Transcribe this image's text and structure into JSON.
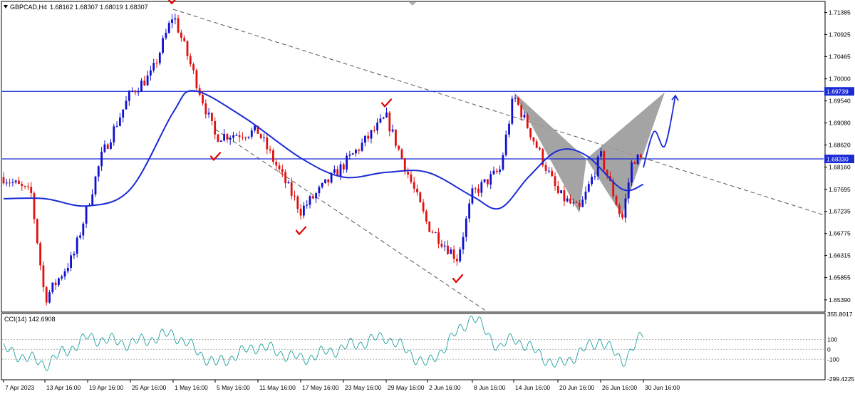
{
  "symbol_header": {
    "symbol": "GBPCAD,H4",
    "ohlc": "1.68162 1.68307 1.68019 1.68307"
  },
  "price_axis": {
    "ticks": [
      "1.71385",
      "1.70925",
      "1.70465",
      "1.70000",
      "1.69540",
      "1.69080",
      "1.68620",
      "1.68160",
      "1.67695",
      "1.67235",
      "1.66775",
      "1.66315",
      "1.65855",
      "1.65390"
    ],
    "range": [
      1.6515,
      1.716
    ]
  },
  "cci_panel": {
    "label": "CCI(14) 142.6908",
    "ticks": [
      "355.8017",
      "100",
      "0",
      "-100",
      "-299.4225"
    ],
    "range": [
      -299.4225,
      355.8017
    ],
    "levels": [
      100,
      0,
      -100
    ]
  },
  "time_axis": {
    "labels": [
      "7 Apr 2023",
      "13 Apr 16:00",
      "19 Apr 16:00",
      "25 Apr 16:00",
      "1 May 16:00",
      "5 May 16:00",
      "11 May 16:00",
      "17 May 16:00",
      "23 May 16:00",
      "29 May 16:00",
      "2 Jun 16:00",
      "8 Jun 16:00",
      "14 Jun 16:00",
      "20 Jun 16:00",
      "26 Jun 16:00",
      "30 Jun 16:00"
    ]
  },
  "horizontal_levels": [
    {
      "price": 1.69739,
      "label": "1.69739"
    },
    {
      "price": 1.6833,
      "label": "1.68330"
    }
  ],
  "colors": {
    "bull": "#1010d0",
    "bear": "#e01010",
    "moving_average": "#1a2bd6",
    "level_line": "#1a2bd6",
    "channel": "#555555",
    "cci": "#20a0a0",
    "pattern_fill": "#9a9a9a",
    "checkmark": "#e00000"
  },
  "chart_data": {
    "type": "candlestick",
    "symbol": "GBPCAD",
    "timeframe": "H4",
    "date_range": [
      "7 Apr 2023",
      "30 Jun 16:00"
    ],
    "last_close": 1.68307,
    "price_path": [
      {
        "date": "7 Apr",
        "price": 1.6795
      },
      {
        "date": "11 Apr",
        "price": 1.676
      },
      {
        "date": "13 Apr",
        "price": 1.654
      },
      {
        "date": "17 Apr",
        "price": 1.663
      },
      {
        "date": "21 Apr",
        "price": 1.684
      },
      {
        "date": "25 Apr",
        "price": 1.697
      },
      {
        "date": "28 Apr",
        "price": 1.701
      },
      {
        "date": "1 May",
        "price": 1.7135
      },
      {
        "date": "5 May",
        "price": 1.688
      },
      {
        "date": "11 May",
        "price": 1.689
      },
      {
        "date": "17 May",
        "price": 1.6725
      },
      {
        "date": "23 May",
        "price": 1.682
      },
      {
        "date": "29 May",
        "price": 1.692
      },
      {
        "date": "2 Jun",
        "price": 1.6695
      },
      {
        "date": "6 Jun",
        "price": 1.6625
      },
      {
        "date": "8 Jun",
        "price": 1.676
      },
      {
        "date": "12 Jun",
        "price": 1.681
      },
      {
        "date": "14 Jun",
        "price": 1.6965
      },
      {
        "date": "20 Jun",
        "price": 1.676
      },
      {
        "date": "23 Jun",
        "price": 1.6725
      },
      {
        "date": "26 Jun",
        "price": 1.684
      },
      {
        "date": "28 Jun",
        "price": 1.6705
      },
      {
        "date": "29 Jun",
        "price": 1.6835
      },
      {
        "date": "30 Jun",
        "price": 1.6831
      }
    ],
    "moving_average_path": [
      {
        "date": "7 Apr",
        "price": 1.675
      },
      {
        "date": "13 Apr",
        "price": 1.675
      },
      {
        "date": "19 Apr",
        "price": 1.6735
      },
      {
        "date": "25 Apr",
        "price": 1.677
      },
      {
        "date": "1 May",
        "price": 1.693
      },
      {
        "date": "3 May",
        "price": 1.6975
      },
      {
        "date": "9 May",
        "price": 1.692
      },
      {
        "date": "17 May",
        "price": 1.6835
      },
      {
        "date": "23 May",
        "price": 1.6795
      },
      {
        "date": "29 May",
        "price": 1.6805
      },
      {
        "date": "2 Jun",
        "price": 1.6805
      },
      {
        "date": "8 Jun",
        "price": 1.6755
      },
      {
        "date": "12 Jun",
        "price": 1.673
      },
      {
        "date": "16 Jun",
        "price": 1.6795
      },
      {
        "date": "20 Jun",
        "price": 1.685
      },
      {
        "date": "24 Jun",
        "price": 1.684
      },
      {
        "date": "28 Jun",
        "price": 1.677
      },
      {
        "date": "30 Jun",
        "price": 1.678
      }
    ],
    "cci_path": [
      {
        "date": "7 Apr",
        "value": 0
      },
      {
        "date": "13 Apr",
        "value": -150
      },
      {
        "date": "19 Apr",
        "value": 120
      },
      {
        "date": "25 Apr",
        "value": 60
      },
      {
        "date": "1 May",
        "value": 160
      },
      {
        "date": "5 May",
        "value": -150
      },
      {
        "date": "11 May",
        "value": 40
      },
      {
        "date": "17 May",
        "value": -100
      },
      {
        "date": "23 May",
        "value": 20
      },
      {
        "date": "29 May",
        "value": 130
      },
      {
        "date": "2 Jun",
        "value": -160
      },
      {
        "date": "8 Jun",
        "value": 340
      },
      {
        "date": "12 Jun",
        "value": 10
      },
      {
        "date": "14 Jun",
        "value": 120
      },
      {
        "date": "20 Jun",
        "value": -170
      },
      {
        "date": "26 Jun",
        "value": 100
      },
      {
        "date": "28 Jun",
        "value": -120
      },
      {
        "date": "30 Jun",
        "value": 142.6908
      }
    ],
    "descending_channel": {
      "upper": [
        {
          "date": "1 May",
          "price": 1.7145
        },
        {
          "date": "30 Jun",
          "price": 1.6835
        }
      ],
      "lower": [
        {
          "date": "5 May",
          "price": 1.6895
        },
        {
          "date": "8 Jun",
          "price": 1.6535
        }
      ]
    },
    "harmonic_pattern": [
      {
        "date": "14 Jun",
        "price": 1.6972
      },
      {
        "date": "23 Jun",
        "price": 1.672
      },
      {
        "date": "24 Jun",
        "price": 1.6833
      },
      {
        "date": "28 Jun",
        "price": 1.6715
      },
      {
        "date": "2 Jul",
        "price": 1.6972
      }
    ],
    "projection_path": [
      {
        "date": "30 Jun",
        "price": 1.6815
      },
      {
        "date": "1 Jul",
        "price": 1.689
      },
      {
        "date": "2 Jul",
        "price": 1.686
      },
      {
        "date": "3 Jul",
        "price": 1.6965
      }
    ],
    "checkmark_dates": [
      "1 May",
      "5 May",
      "17 May",
      "29 May",
      "6 Jun"
    ]
  }
}
